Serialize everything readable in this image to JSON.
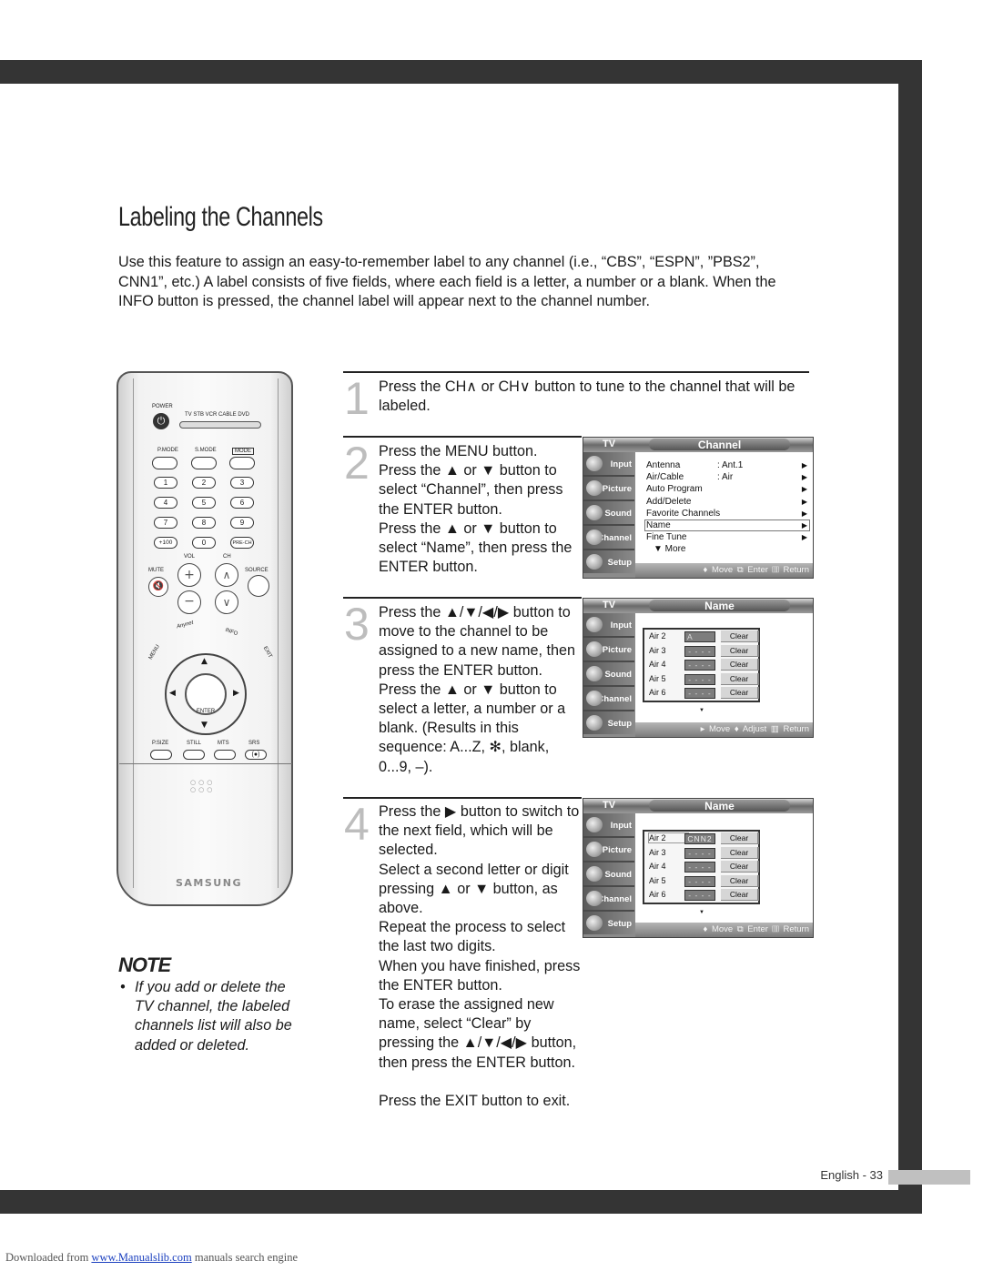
{
  "page": {
    "title": "Labeling the Channels",
    "intro": "Use this feature to assign an easy-to-remember label to any channel (i.e., “CBS”, “ESPN”, ”PBS2”, CNN1”, etc.) A label consists of five fields, where each field is a letter, a number or a blank. When the INFO button is pressed, the channel label will appear next to the channel number.",
    "page_number": "English - 33"
  },
  "steps": [
    {
      "num": "1",
      "lines": [
        "Press the CH∧ or CH∨ button to tune to the channel that will be labeled."
      ]
    },
    {
      "num": "2",
      "lines": [
        "Press the MENU button.",
        "Press the ▲ or ▼ button to select “Channel”, then press the ENTER button.",
        "Press the ▲ or ▼ button to select “Name”, then press the ENTER button."
      ]
    },
    {
      "num": "3",
      "lines": [
        "Press the ▲/▼/◀/▶ button to move to the channel to be assigned to a new name, then press the ENTER button.",
        "Press the ▲ or ▼ button to select a letter, a number or a blank. (Results in this sequence: A...Z, ✻, blank, 0...9, –)."
      ]
    },
    {
      "num": "4",
      "lines": [
        "Press the ▶ button to switch to the next field, which will be selected.",
        "Select a second letter or digit pressing ▲ or ▼ button, as above.",
        "Repeat the process to select the last two digits.",
        "When you have finished, press the ENTER button.",
        "To erase the assigned new name, select “Clear” by pressing the ▲/▼/◀/▶ button, then press the ENTER button."
      ]
    }
  ],
  "exit_text": "Press the EXIT button to exit.",
  "osd": {
    "tv_label": "TV",
    "sidebar": [
      "Input",
      "Picture",
      "Sound",
      "Channel",
      "Setup"
    ],
    "channel_menu": {
      "title": "Channel",
      "items": [
        {
          "label": "Antenna",
          "value": ": Ant.1",
          "arrow": "▶"
        },
        {
          "label": "Air/Cable",
          "value": ": Air",
          "arrow": "▶"
        },
        {
          "label": "Auto Program",
          "value": "",
          "arrow": "▶"
        },
        {
          "label": "Add/Delete",
          "value": "",
          "arrow": "▶"
        },
        {
          "label": "Favorite Channels",
          "value": "",
          "arrow": "▶"
        },
        {
          "label": "Name",
          "value": "",
          "arrow": "▶",
          "selected": true
        },
        {
          "label": "Fine Tune",
          "value": "",
          "arrow": "▶"
        },
        {
          "label": "▼ More",
          "value": "",
          "arrow": ""
        }
      ],
      "footer": "♦ Move  ⧉ Enter  ▥ Return"
    },
    "name_menu_1": {
      "title": "Name",
      "rows": [
        {
          "label": "Air  2",
          "field": "A",
          "clear": "Clear"
        },
        {
          "label": "Air  3",
          "field": "- - - -",
          "clear": "Clear"
        },
        {
          "label": "Air  4",
          "field": "- - - -",
          "clear": "Clear"
        },
        {
          "label": "Air  5",
          "field": "- - - -",
          "clear": "Clear"
        },
        {
          "label": "Air  6",
          "field": "- - - -",
          "clear": "Clear"
        }
      ],
      "footer": "▸ Move  ♦ Adjust  ▥ Return"
    },
    "name_menu_2": {
      "title": "Name",
      "rows": [
        {
          "label": "Air  2",
          "field": "CNN2",
          "clear": "Clear"
        },
        {
          "label": "Air  3",
          "field": "- - - -",
          "clear": "Clear"
        },
        {
          "label": "Air  4",
          "field": "- - - -",
          "clear": "Clear"
        },
        {
          "label": "Air  5",
          "field": "- - - -",
          "clear": "Clear"
        },
        {
          "label": "Air  6",
          "field": "- - - -",
          "clear": "Clear"
        }
      ],
      "footer": "♦ Move  ⧉ Enter  ▥ Return"
    }
  },
  "remote": {
    "power": "POWER",
    "modes": "TV  STB  VCR  CABLE  DVD",
    "pmode": "P.MODE",
    "smode": "S.MODE",
    "mode": "MODE",
    "digits": [
      "1",
      "2",
      "3",
      "4",
      "5",
      "6",
      "7",
      "8",
      "9",
      "+100",
      "0",
      "PRE-CH"
    ],
    "vol": "VOL",
    "ch": "CH",
    "mute": "MUTE",
    "source": "SOURCE",
    "anynet": "Anynet",
    "info": "INFO",
    "menu": "MENU",
    "exit": "EXIT",
    "enter": "ENTER",
    "bottom": [
      "P.SIZE",
      "STILL",
      "MTS",
      "SRS"
    ],
    "brand": "SAMSUNG"
  },
  "note": {
    "title": "NOTE",
    "bullet": "•",
    "text": "If you add or delete the TV channel, the labeled channels list will also be added or deleted."
  },
  "footer": {
    "prefix": "Downloaded from",
    "link": "www.Manualslib.com",
    "suffix": "manuals search engine"
  }
}
